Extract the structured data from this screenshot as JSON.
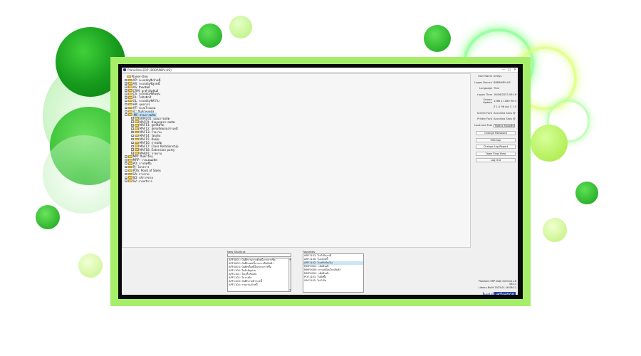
{
  "window": {
    "title": "PlaneOne ERP (BRBANDV-HS)",
    "controls": [
      "—",
      "□",
      "✕"
    ]
  },
  "tree": {
    "root": "Planer-One",
    "modules": [
      {
        "label": "AP: ระบบบัญชีเจ้าหนี้",
        "expander": "+"
      },
      {
        "label": "AR: ระบบบัญชีลูกหนี้",
        "expander": "+"
      },
      {
        "label": "AS: สินทรัพย์",
        "expander": "+"
      },
      {
        "label": "CRM: ลูกค้าสัมพันธ์",
        "expander": "+"
      },
      {
        "label": "CS: ระบบบัญชีต้นทุน",
        "expander": "+"
      },
      {
        "label": "DL: โลจิสติกส์",
        "expander": "+"
      },
      {
        "label": "GL: ระบบบัญชีทั่วไป",
        "expander": "+"
      },
      {
        "label": "HR: บุคลากร",
        "expander": "+"
      },
      {
        "label": "HT: ระบบโรงแรม",
        "expander": "+"
      },
      {
        "label": "IC: สินค้าคงคลัง",
        "expander": "+"
      },
      {
        "label": "MF: ส่วนการผลิต",
        "expander": "−",
        "selected": true,
        "children": [
          {
            "label": "ERM201: แผนการผลิต"
          },
          {
            "label": "MAF01: ข้อมูลสูตรการผลิต"
          },
          {
            "label": "MAF11: สูตรลิควิด"
          },
          {
            "label": "MAF12: สูตรผลิตผสมสารเคมี"
          },
          {
            "label": "MAF13: รายงาน"
          },
          {
            "label": "MAF14: วัตถุดิบ"
          },
          {
            "label": "MAF15: ต้นทุน"
          },
          {
            "label": "MAF16: การผลิต"
          },
          {
            "label": "MAF17: Class Relationship"
          },
          {
            "label": "MAF18: Extension party"
          },
          {
            "label": "MAR01: รายงาน"
          }
        ]
      },
      {
        "label": "MM: สินค้าวัตถุ",
        "expander": "+"
      },
      {
        "label": "MRP: วางแผนผลิต",
        "expander": "+"
      },
      {
        "label": "PO: การจัดซื้อ",
        "expander": "+"
      },
      {
        "label": "PJ: โครงการ",
        "expander": "+"
      },
      {
        "label": "POS: Point of Sales",
        "expander": "+"
      },
      {
        "label": "SA: การขาย",
        "expander": "+"
      },
      {
        "label": "SD: บริการขาย",
        "expander": "+"
      },
      {
        "label": "SV: งานบริการ",
        "expander": "+"
      }
    ]
  },
  "info": {
    "user_name_label": "User Name",
    "user_name": "brdtys",
    "logon_branch_label": "Logon Branch",
    "logon_branch": "BRBANDV-HS",
    "language_label": "Language",
    "language": "Thai",
    "logon_time_label": "Logon Time",
    "logon_time": "16/06/2023 09:16:11",
    "screen_update_label": "Screen Update",
    "screen_update": "1366 x 1080 96 dpi",
    "screen_update_2": "Z 1.0 96 dpi C 1.0 1.0",
    "screen_font_label": "Screen Font",
    "screen_font": "Arundina Sans @ 10",
    "printer_font_label": "Printer Font",
    "printer_font": "Arundina Sans @ 10",
    "look_and_feel_label": "Look and Feel",
    "look_and_feel": "Moftrix Modern"
  },
  "buttons": {
    "change_password": "Change Password",
    "sitemap": "Sitemap",
    "change_log_report": "Change Log Report",
    "open_flow_view": "Open Flow View",
    "log_out": "Log Out"
  },
  "version": {
    "line1": "Planeone ERP Date 2023-01-16 08:11",
    "line2": "Library Build 2023-01-16 08:11"
  },
  "logo": {
    "part1": "brid",
    "part2": "advance"
  },
  "new_shortcut": {
    "title": "New Shortcut",
    "items": [
      "APF0001: บันทึกรายการตั้งหนี้จากการซื้อ",
      "APF0002: บันทึกลดหนี้จากการคืนสินค้า",
      "APF0003: บันทึกตั้งหนี้อื่นๆจากการซื้อ",
      "APF1100: ใบสำคัญจ่าย",
      "APF1101: ใบเสร็จรับเงิน",
      "APF1102: ใบวางบิล",
      "APF1103: บันทึกจ่ายชำระหนี้",
      "APF1104: รายงานเจ้าหนี้"
    ]
  },
  "favorites": {
    "title": "Favorites",
    "items": [
      {
        "label": "ARF1101: ใบกำกับภาษี"
      },
      {
        "label": "ARF1100: ใบแจ้งหนี้"
      },
      {
        "label": "ARF1102: ใบเสร็จรับเงิน",
        "selected": true
      },
      {
        "label": "MMF0001: รหัสสินค้า"
      },
      {
        "label": "MMF0005: การเคลื่อนไหวสินค้า"
      },
      {
        "label": "MMF0001: รหัสสินค้า"
      },
      {
        "label": "POF1101: ใบสั่งซื้อ"
      },
      {
        "label": "SAF1102: ใบกำกับ"
      }
    ]
  }
}
